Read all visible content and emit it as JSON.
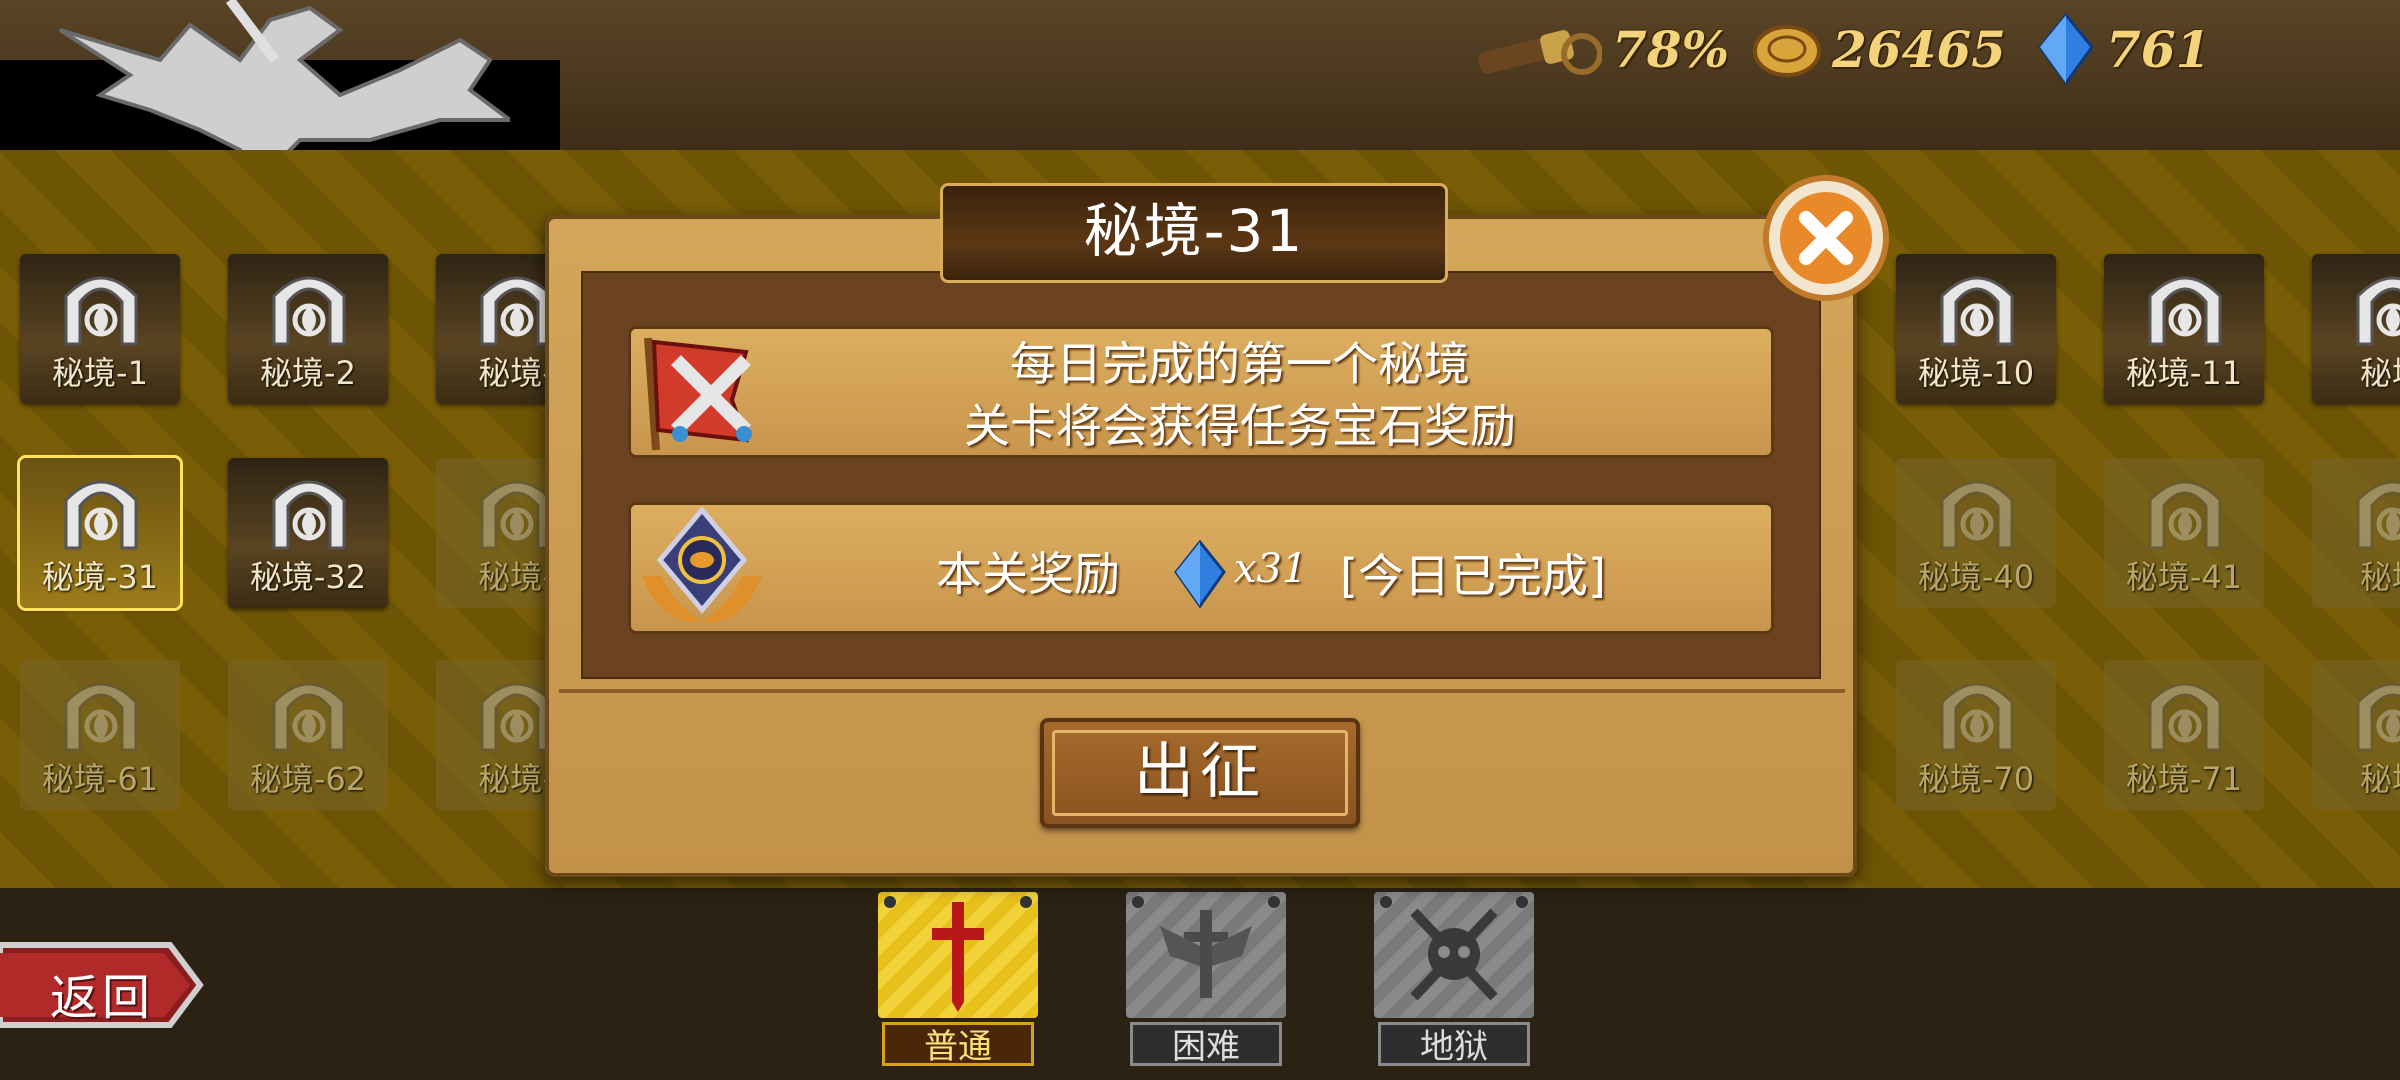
{
  "hud": {
    "scope_percent": "78%",
    "coins": "26465",
    "gems": "761"
  },
  "levels": [
    {
      "label": "秘境-1"
    },
    {
      "label": "秘境-2"
    },
    {
      "label": "秘境-"
    },
    {
      "label": "秘境-10"
    },
    {
      "label": "秘境-11"
    },
    {
      "label": "秘境"
    },
    {
      "label": "秘境-31"
    },
    {
      "label": "秘境-32"
    },
    {
      "label": "秘境-"
    },
    {
      "label": "秘境-40"
    },
    {
      "label": "秘境-41"
    },
    {
      "label": "秘境"
    },
    {
      "label": "秘境-61"
    },
    {
      "label": "秘境-62"
    },
    {
      "label": "秘境-"
    },
    {
      "label": "秘境-70"
    },
    {
      "label": "秘境-71"
    },
    {
      "label": "秘境"
    }
  ],
  "modal": {
    "title": "秘境-31",
    "info_line1": "每日完成的第一个秘境",
    "info_line2": "关卡将会获得任务宝石奖励",
    "reward_label": "本关奖励",
    "reward_amount": "x31",
    "reward_status": "[今日已完成]",
    "go_label": "出征"
  },
  "difficulty": {
    "normal": "普通",
    "hard": "困难",
    "hell": "地狱"
  },
  "back_label": "返回",
  "colors": {
    "accent": "#e8c01a",
    "gem": "#2f7fe0",
    "coin": "#d9a53a"
  }
}
